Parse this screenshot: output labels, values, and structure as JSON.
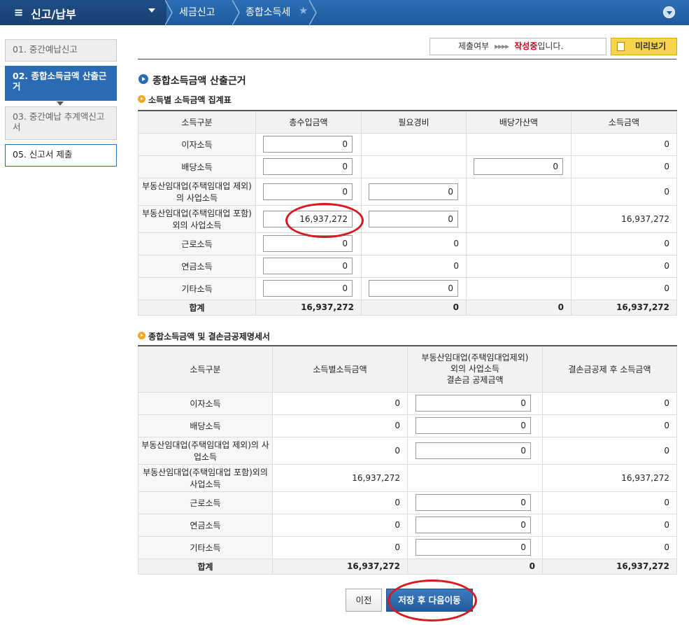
{
  "topbar": {
    "menu_label": "신고/납부",
    "breadcrumbs": [
      "세금신고",
      "종합소득세"
    ],
    "colors": {
      "bar": "#2d6fb5",
      "menu": "#1f4e86"
    }
  },
  "steps": [
    {
      "label": "01. 중간예납신고"
    },
    {
      "label": "02. 종합소득금액 산출근거"
    },
    {
      "label": "03. 중간예납 추계액신고서"
    },
    {
      "label": "05. 신고서 제출"
    }
  ],
  "status": {
    "prefix": "제출여부",
    "arrows": "▸▸▸▸",
    "state": "작성중",
    "suffix": "입니다.",
    "preview_label": "미리보기"
  },
  "main_title": "종합소득금액 산출근거",
  "table1": {
    "title": "소득별 소득금액 집계표",
    "headers": [
      "소득구분",
      "총수입금액",
      "필요경비",
      "배당가산액",
      "소득금액"
    ],
    "rows": [
      {
        "label": "이자소득",
        "revenue": "0",
        "expense": "",
        "dividend": "",
        "income": "0"
      },
      {
        "label": "배당소득",
        "revenue": "0",
        "expense": "",
        "dividend": "0",
        "income": "0"
      },
      {
        "label": "부동산임대업(주택임대업 제외)의 사업소득",
        "revenue": "0",
        "expense": "0",
        "dividend": "",
        "income": "0"
      },
      {
        "label": "부동산임대업(주택임대업 포함)외의 사업소득",
        "revenue": "16,937,272",
        "expense": "0",
        "dividend": "",
        "income": "16,937,272"
      },
      {
        "label": "근로소득",
        "revenue": "0",
        "expense": "0",
        "dividend": "",
        "income": "0"
      },
      {
        "label": "연금소득",
        "revenue": "0",
        "expense": "0",
        "dividend": "",
        "income": "0"
      },
      {
        "label": "기타소득",
        "revenue": "0",
        "expense": "0",
        "dividend": "",
        "income": "0"
      }
    ],
    "sum": {
      "label": "합계",
      "revenue": "16,937,272",
      "expense": "0",
      "dividend": "0",
      "income": "16,937,272"
    }
  },
  "table2": {
    "title": "종합소득금액 및 결손금공제명세서",
    "headers": [
      "소득구분",
      "소득별소득금액",
      "부동산임대업(주택임대업제외)\n외의 사업소득\n결손금 공제금액",
      "결손금공제 후 소득금액"
    ],
    "rows": [
      {
        "label": "이자소득",
        "income": "0",
        "deduction": "0",
        "after": "0"
      },
      {
        "label": "배당소득",
        "income": "0",
        "deduction": "0",
        "after": "0"
      },
      {
        "label": "부동산임대업(주택임대업 제외)의 사업소득",
        "income": "0",
        "deduction": "0",
        "after": "0"
      },
      {
        "label": "부동산임대업(주택임대업 포함)외의 사업소득",
        "income": "16,937,272",
        "deduction": "",
        "after": "16,937,272"
      },
      {
        "label": "근로소득",
        "income": "0",
        "deduction": "0",
        "after": "0"
      },
      {
        "label": "연금소득",
        "income": "0",
        "deduction": "0",
        "after": "0"
      },
      {
        "label": "기타소득",
        "income": "0",
        "deduction": "0",
        "after": "0"
      }
    ],
    "sum": {
      "label": "합계",
      "income": "16,937,272",
      "deduction": "0",
      "after": "16,937,272"
    }
  },
  "buttons": {
    "prev": "이전",
    "next": "저장 후 다음이동"
  }
}
